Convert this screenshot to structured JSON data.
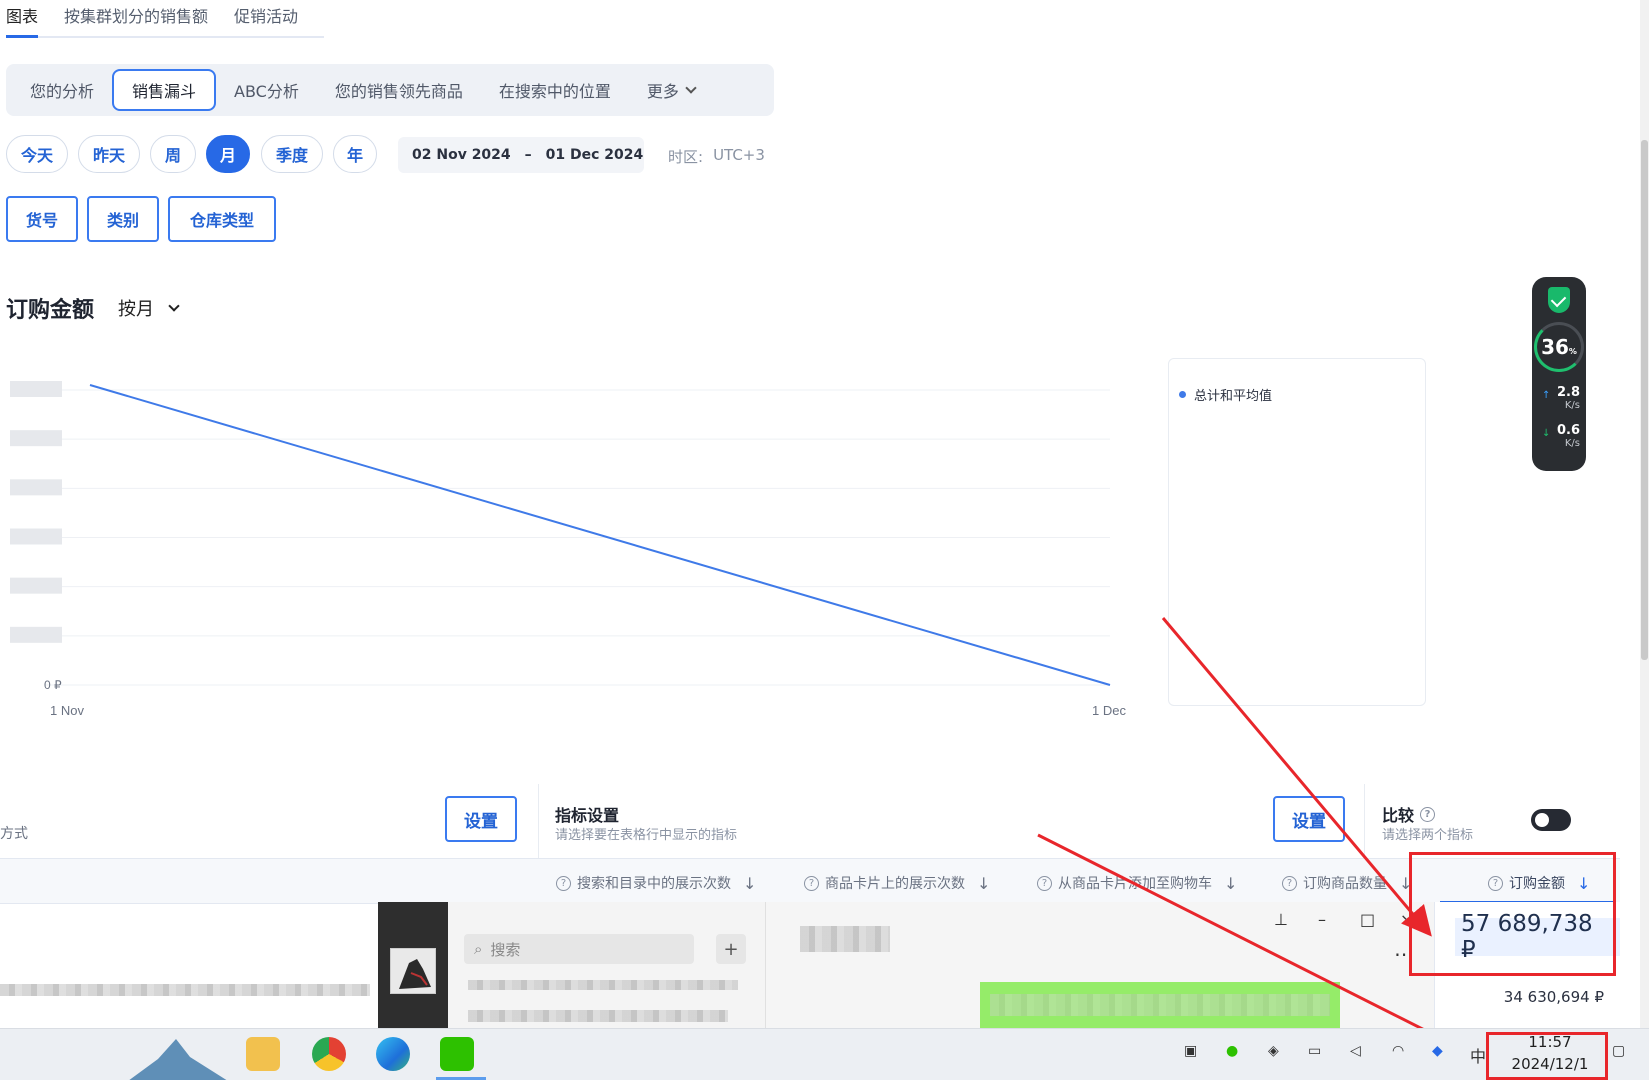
{
  "top_tabs": [
    "图表",
    "按集群划分的销售额",
    "促销活动"
  ],
  "analysis_tabs": [
    "您的分析",
    "销售漏斗",
    "ABC分析",
    "您的销售领先商品",
    "在搜索中的位置",
    "更多"
  ],
  "periods": [
    "今天",
    "昨天",
    "周",
    "月",
    "季度",
    "年"
  ],
  "date_range": {
    "start": "02 Nov 2024",
    "sep": "–",
    "end": "01 Dec 2024"
  },
  "timezone": {
    "label": "时区:",
    "value": "UTC+3"
  },
  "filters": [
    "货号",
    "类别",
    "仓库类型"
  ],
  "chart_header": {
    "title": "订购金额",
    "granularity": "按月"
  },
  "chart_data": {
    "type": "line",
    "x": [
      "1 Nov",
      "1 Dec"
    ],
    "series": [
      {
        "name": "总计和平均值",
        "values": [
          57689738,
          0
        ]
      }
    ],
    "ylabel": "",
    "ylim_bottom_label": "0 ₽",
    "grid": true,
    "legend": "right",
    "color": "#3f7ae8"
  },
  "legend_label": "总计和平均值",
  "speed_widget": {
    "percent": "36",
    "percent_unit": "%",
    "up": "2.8",
    "down": "0.6",
    "unit": "K/s"
  },
  "bottom_panel": {
    "left_cut_label": "方式",
    "settings_label": "设置",
    "metrics_title": "指标设置",
    "metrics_sub": "请选择要在表格行中显示的指标",
    "compare_title": "比较",
    "compare_sub": "请选择两个指标"
  },
  "table_headers": [
    "搜索和目录中的展示次数",
    "商品卡片上的展示次数",
    "从商品卡片添加至购物车",
    "订购商品数量",
    "订购金额"
  ],
  "values": {
    "highlight": "57 689,738 ₽",
    "second": "34 630,694 ₽"
  },
  "messenger": {
    "search_placeholder": "搜索",
    "plus": "+"
  },
  "taskbar": {
    "ime": "中",
    "time": "11:57",
    "date": "2024/12/1"
  },
  "colors": {
    "accent": "#2769e6",
    "highlight": "#e8262b"
  }
}
